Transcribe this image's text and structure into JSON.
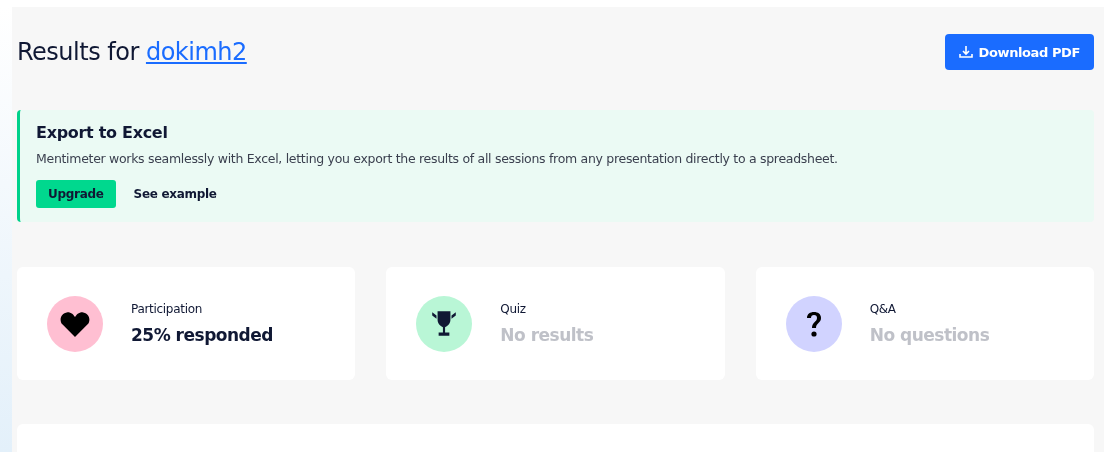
{
  "header": {
    "title_prefix": "Results for",
    "presentation_link": "dokimh2",
    "download_button": "Download PDF"
  },
  "banner": {
    "title": "Export to Excel",
    "text": "Mentimeter works seamlessly with Excel, letting you export the results of all sessions from any presentation directly to a spreadsheet.",
    "primary_button": "Upgrade",
    "secondary_link": "See example"
  },
  "stats": [
    {
      "kind": "heart",
      "color": "#ffbfd2",
      "label": "Participation",
      "value": "25% responded",
      "empty": false
    },
    {
      "kind": "trophy",
      "color": "#b9f6d6",
      "label": "Quiz",
      "value": "No results",
      "empty": true
    },
    {
      "kind": "question",
      "color": "#d1d3ff",
      "label": "Q&A",
      "value": "No questions",
      "empty": true
    }
  ]
}
